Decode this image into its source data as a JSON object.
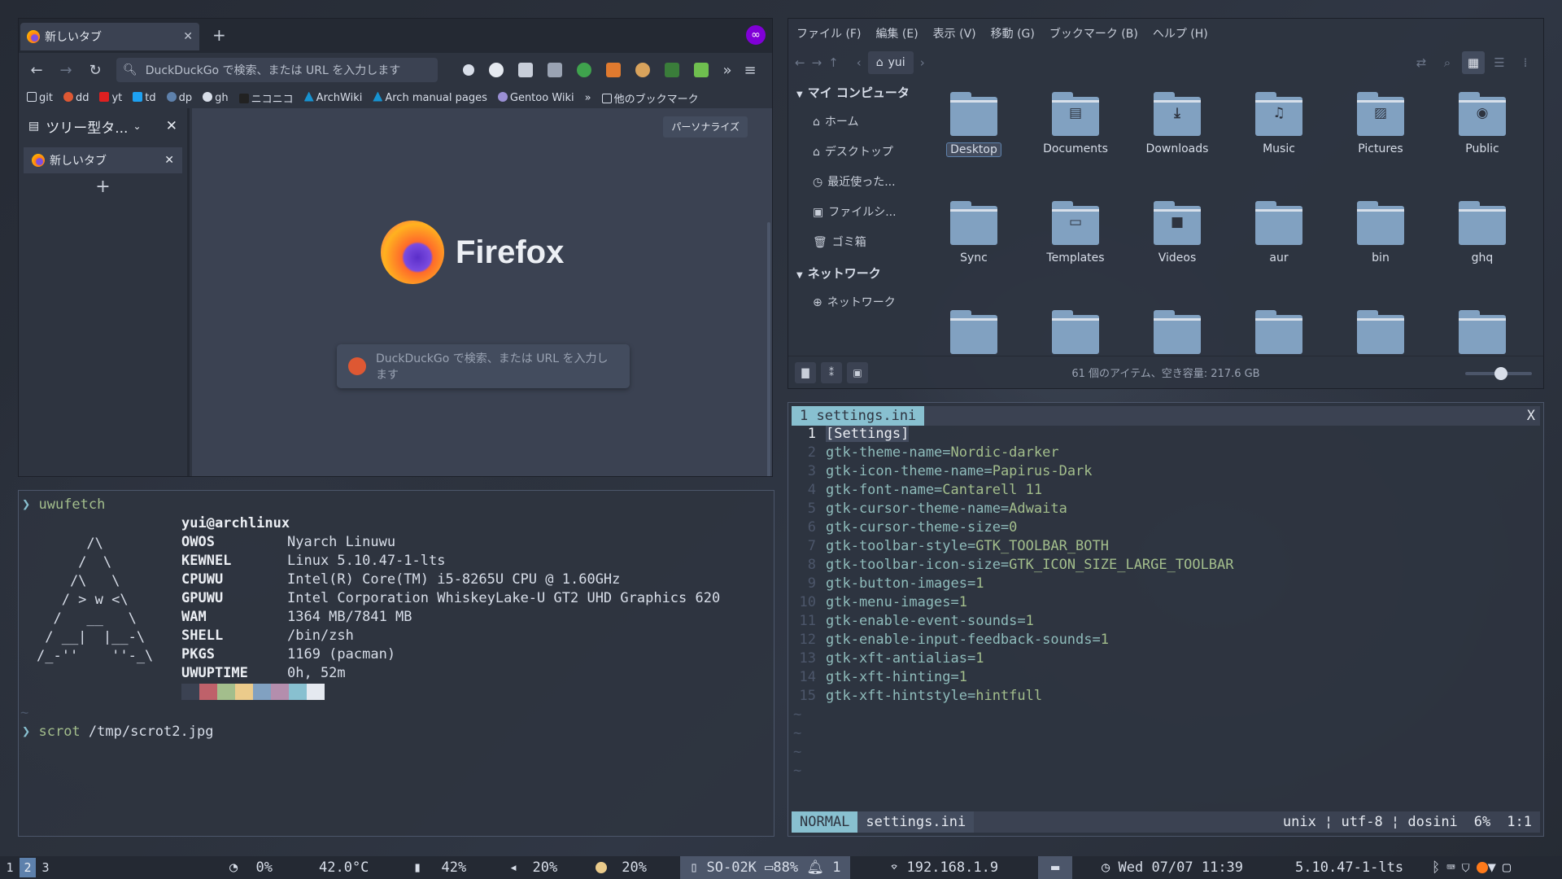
{
  "firefox": {
    "tab_title": "新しいタブ",
    "url_placeholder": "DuckDuckGo で検索、または URL を入力します",
    "bookmarks": [
      "git",
      "dd",
      "yt",
      "td",
      "dp",
      "gh",
      "ニコニコ",
      "ArchWiki",
      "Arch manual pages",
      "Gentoo Wiki",
      "他のブックマーク"
    ],
    "sidebar_title": "ツリー型タ...",
    "sidebar_tab": "新しいタブ",
    "personalize": "パーソナライズ",
    "brand": "Firefox",
    "search_hint": "DuckDuckGo で検索、または URL を入力します"
  },
  "terminal": {
    "prompt1": "uwufetch",
    "user": "yui@archlinux",
    "info": [
      {
        "k": "OWOS",
        "v": "Nyarch Linuwu"
      },
      {
        "k": "KEWNEL",
        "v": "Linux 5.10.47-1-lts"
      },
      {
        "k": "CPUWU",
        "v": "Intel(R) Core(TM) i5-8265U CPU @ 1.60GHz"
      },
      {
        "k": "GPUWU",
        "v": "Intel Corporation WhiskeyLake-U GT2 UHD Graphics 620"
      },
      {
        "k": "WAM",
        "v": "1364 MB/7841 MB"
      },
      {
        "k": "SHELL",
        "v": "/bin/zsh"
      },
      {
        "k": "PKGS",
        "v": "1169 (pacman)"
      },
      {
        "k": "UWUPTIME",
        "v": "0h, 52m"
      }
    ],
    "palette": [
      "#3b4252",
      "#bf616a",
      "#a3be8c",
      "#ebcb8b",
      "#81a1c1",
      "#b48ead",
      "#88c0d0",
      "#e5e9f0"
    ],
    "prompt2_cmd": "scrot",
    "prompt2_arg": "/tmp/scrot2.jpg"
  },
  "filemanager": {
    "menu": [
      "ファイル (F)",
      "編集 (E)",
      "表示 (V)",
      "移動 (G)",
      "ブックマーク (B)",
      "ヘルプ (H)"
    ],
    "crumb": "yui",
    "sections": [
      {
        "title": "マイ コンピュータ",
        "items": [
          "ホーム",
          "デスクトップ",
          "最近使った...",
          "ファイルシ...",
          "ゴミ箱"
        ]
      },
      {
        "title": "ネットワーク",
        "items": [
          "ネットワーク"
        ]
      }
    ],
    "folders": [
      "Desktop",
      "Documents",
      "Downloads",
      "Music",
      "Pictures",
      "Public",
      "Sync",
      "Templates",
      "Videos",
      "aur",
      "bin",
      "ghq"
    ],
    "status": "61 個のアイテム、空き容量: 217.6 GB"
  },
  "vim": {
    "tab": "1 settings.ini",
    "close": "X",
    "lines": [
      [
        "[Settings]",
        ""
      ],
      [
        "gtk-theme-name=",
        "Nordic-darker"
      ],
      [
        "gtk-icon-theme-name=",
        "Papirus-Dark"
      ],
      [
        "gtk-font-name=",
        "Cantarell 11"
      ],
      [
        "gtk-cursor-theme-name=",
        "Adwaita"
      ],
      [
        "gtk-cursor-theme-size=",
        "0"
      ],
      [
        "gtk-toolbar-style=",
        "GTK_TOOLBAR_BOTH"
      ],
      [
        "gtk-toolbar-icon-size=",
        "GTK_ICON_SIZE_LARGE_TOOLBAR"
      ],
      [
        "gtk-button-images=",
        "1"
      ],
      [
        "gtk-menu-images=",
        "1"
      ],
      [
        "gtk-enable-event-sounds=",
        "1"
      ],
      [
        "gtk-enable-input-feedback-sounds=",
        "1"
      ],
      [
        "gtk-xft-antialias=",
        "1"
      ],
      [
        "gtk-xft-hinting=",
        "1"
      ],
      [
        "gtk-xft-hintstyle=",
        "hintfull"
      ]
    ],
    "mode": "NORMAL",
    "file": "settings.ini",
    "fmt": "unix ¦ utf-8 ¦ dosini",
    "pct": "6%",
    "pos": "1:1"
  },
  "bar": {
    "workspaces": [
      "1",
      "2",
      "3"
    ],
    "cpu": "0%",
    "temp": "42.0°C",
    "mem": "42%",
    "vol": "20%",
    "bright": "20%",
    "device": "SO-02K",
    "phone_bat": "88%",
    "notif": "1",
    "ip": "192.168.1.9",
    "clock": "Wed 07/07 11:39",
    "kernel": "5.10.47-1-lts"
  }
}
